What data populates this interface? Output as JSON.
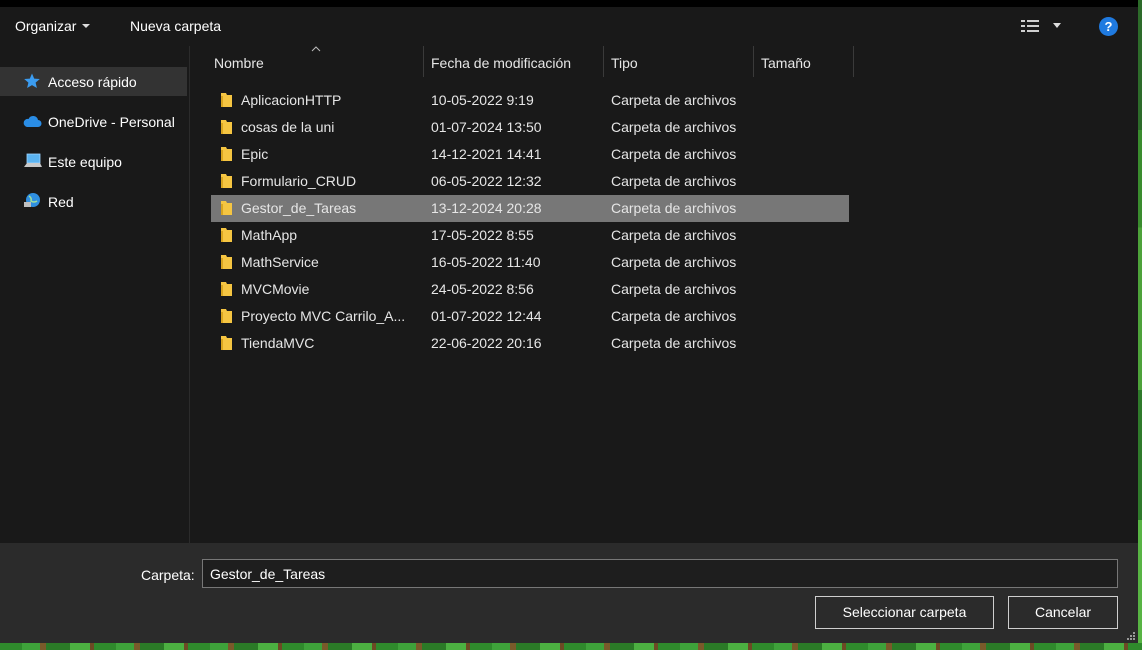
{
  "toolbar": {
    "organize_label": "Organizar",
    "new_folder_label": "Nueva carpeta",
    "view_icon": "details-view-icon",
    "help_label": "?"
  },
  "sidebar": {
    "items": [
      {
        "label": "Acceso rápido",
        "icon": "star-icon"
      },
      {
        "label": "OneDrive - Personal",
        "icon": "cloud-icon"
      },
      {
        "label": "Este equipo",
        "icon": "computer-icon"
      },
      {
        "label": "Red",
        "icon": "network-icon"
      }
    ]
  },
  "columns": {
    "name": "Nombre",
    "date": "Fecha de modificación",
    "type": "Tipo",
    "size": "Tamaño"
  },
  "files": [
    {
      "name": "AplicacionHTTP",
      "date": "10-05-2022 9:19",
      "type": "Carpeta de archivos"
    },
    {
      "name": "cosas de la uni",
      "date": "01-07-2024 13:50",
      "type": "Carpeta de archivos"
    },
    {
      "name": "Epic",
      "date": "14-12-2021 14:41",
      "type": "Carpeta de archivos"
    },
    {
      "name": "Formulario_CRUD",
      "date": "06-05-2022 12:32",
      "type": "Carpeta de archivos"
    },
    {
      "name": "Gestor_de_Tareas",
      "date": "13-12-2024 20:28",
      "type": "Carpeta de archivos",
      "selected": true
    },
    {
      "name": "MathApp",
      "date": "17-05-2022 8:55",
      "type": "Carpeta de archivos"
    },
    {
      "name": "MathService",
      "date": "16-05-2022 11:40",
      "type": "Carpeta de archivos"
    },
    {
      "name": "MVCMovie",
      "date": "24-05-2022 8:56",
      "type": "Carpeta de archivos"
    },
    {
      "name": "Proyecto MVC Carrilo_A...",
      "date": "01-07-2022 12:44",
      "type": "Carpeta de archivos"
    },
    {
      "name": "TiendaMVC",
      "date": "22-06-2022 20:16",
      "type": "Carpeta de archivos"
    }
  ],
  "footer": {
    "folder_label": "Carpeta:",
    "folder_value": "Gestor_de_Tareas",
    "select_button": "Seleccionar carpeta",
    "cancel_button": "Cancelar"
  },
  "colors": {
    "window_bg": "#191919",
    "selected_row": "#777777",
    "footer_bg": "#2b2b2b",
    "help_blue": "#1f7ae0",
    "folder_yellow": "#f5c542"
  }
}
